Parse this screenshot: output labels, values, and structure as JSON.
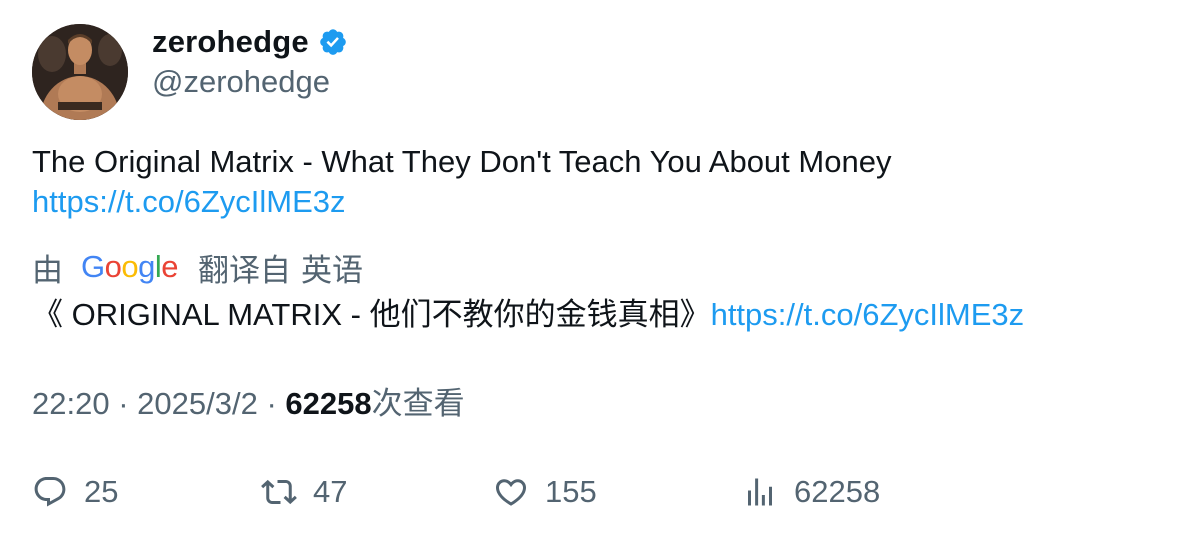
{
  "author": {
    "display_name": "zerohedge",
    "handle": "@zerohedge",
    "verified": true,
    "verified_color": "#1d9bf0"
  },
  "tweet": {
    "text": "The Original Matrix - What They Don't Teach You About Money",
    "link": "https://t.co/6ZycIlME3z"
  },
  "translation": {
    "by_label": "由",
    "provider": "Google",
    "translated_from": "翻译自",
    "language": "英语",
    "text": "《 ORIGINAL MATRIX - 他们不教你的金钱真相》",
    "link": "https://t.co/6ZycIlME3z"
  },
  "meta": {
    "time": "22:20",
    "separator": "·",
    "date": "2025/3/2",
    "views_count": "62258",
    "views_label": "次查看"
  },
  "actions": {
    "replies": "25",
    "retweets": "47",
    "likes": "155",
    "views": "62258"
  },
  "colors": {
    "link": "#1d9bf0",
    "secondary_text": "#536471",
    "primary_text": "#0f1419"
  },
  "icons": [
    "verified-badge-icon",
    "reply-icon",
    "retweet-icon",
    "like-icon",
    "views-icon"
  ]
}
